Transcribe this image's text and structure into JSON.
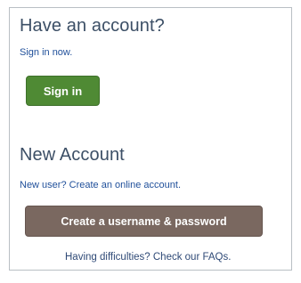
{
  "account_panel": {
    "have_account": {
      "heading": "Have an account?",
      "sign_in_link": "Sign in now.",
      "sign_in_button": "Sign in"
    },
    "new_account": {
      "heading": "New Account",
      "create_link": "New user? Create an online account.",
      "create_button": "Create a username & password"
    },
    "help_link": "Having difficulties? Check our FAQs."
  },
  "colors": {
    "heading_text": "#3c4f66",
    "link_text": "#1f4f9a",
    "sign_in_button_bg": "#4f8a34",
    "create_button_bg": "#7a6860",
    "panel_border": "#b9bfc4"
  }
}
